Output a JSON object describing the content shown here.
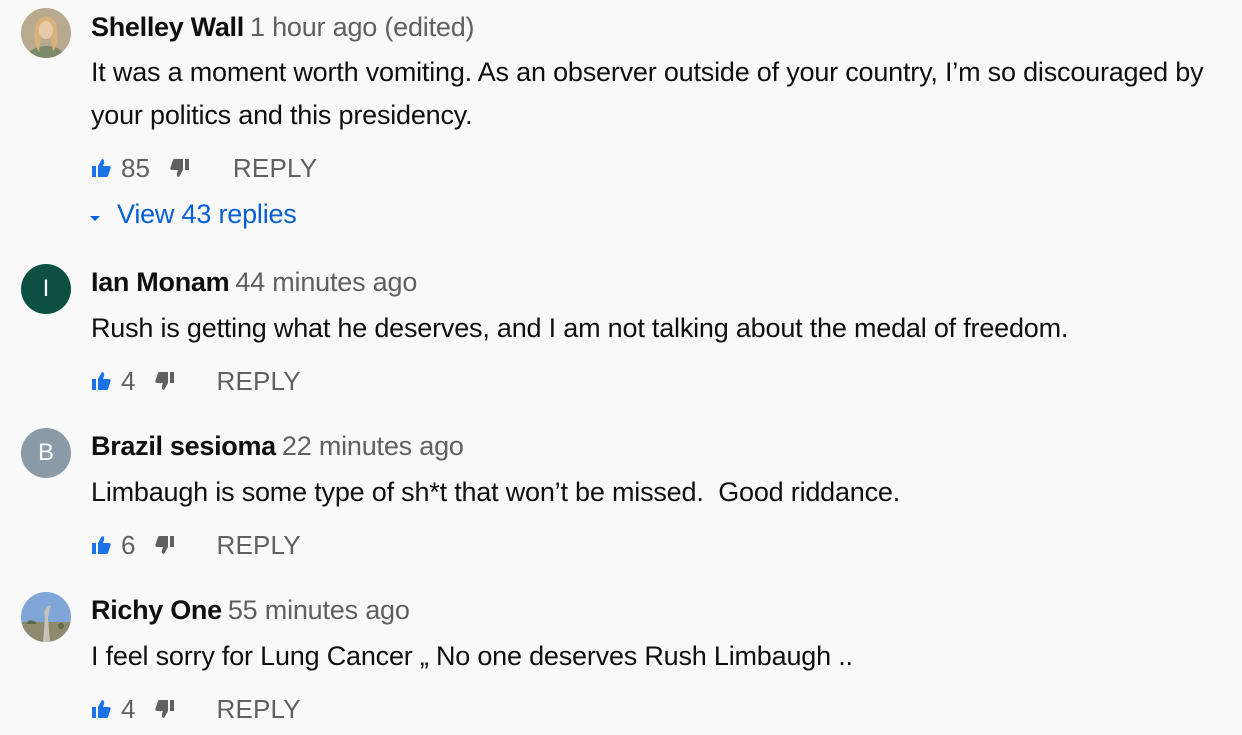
{
  "colors": {
    "background": "#f9f9f9",
    "author_text": "#0f0f0f",
    "meta_text": "#606060",
    "link_blue": "#065fd4",
    "like_blue": "#1a73e8",
    "avatar_ian": "#0b5043",
    "avatar_brazil": "#8a9aa6"
  },
  "icons": {
    "like": "thumb-up-icon",
    "dislike": "thumb-down-icon",
    "expand": "caret-down-icon"
  },
  "comments": [
    {
      "author": "Shelley Wall",
      "time": "1 hour ago (edited)",
      "text": "It was a moment worth vomiting. As an observer outside of your country, I’m so discouraged by your politics and this presidency.",
      "likes": "85",
      "reply_label": "REPLY",
      "view_replies": "View 43 replies",
      "avatar_type": "photo"
    },
    {
      "author": "Ian Monam",
      "time": "44 minutes ago",
      "text": "Rush is getting what he deserves, and I am not talking about the medal of freedom.",
      "likes": "4",
      "reply_label": "REPLY",
      "avatar_letter": "I",
      "avatar_type": "letter"
    },
    {
      "author": "Brazil sesioma",
      "time": "22 minutes ago",
      "text": "Limbaugh is some type of sh*t that won’t be missed.  Good riddance.",
      "likes": "6",
      "reply_label": "REPLY",
      "avatar_letter": "B",
      "avatar_type": "letter"
    },
    {
      "author": "Richy One",
      "time": "55 minutes ago",
      "text": "I feel sorry for Lung Cancer „ No one deserves Rush Limbaugh ..",
      "likes": "4",
      "reply_label": "REPLY",
      "avatar_type": "photo"
    }
  ]
}
